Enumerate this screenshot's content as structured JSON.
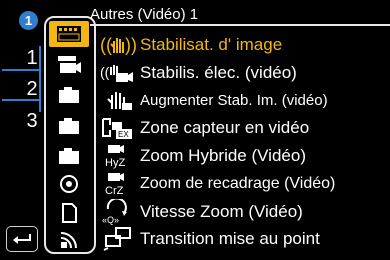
{
  "header": {
    "title": "Autres (Vidéo) 1",
    "page_badge": "1"
  },
  "pages": [
    "1",
    "2",
    "3"
  ],
  "tabs": [
    {
      "icon": "video-film-icon",
      "selected": true
    },
    {
      "icon": "video-camera-icon",
      "selected": false
    },
    {
      "icon": "camera-icon",
      "selected": false
    },
    {
      "icon": "camera-icon",
      "selected": false
    },
    {
      "icon": "camera-icon",
      "selected": false
    },
    {
      "icon": "playback-circle-icon",
      "selected": false
    },
    {
      "icon": "memory-card-icon",
      "selected": false
    },
    {
      "icon": "wireless-signal-icon",
      "selected": false
    }
  ],
  "menu": {
    "items": [
      {
        "label": "Stabilisat. d' image",
        "icon": "hand-shake-icon",
        "active": true
      },
      {
        "label": "Stabilis. élec. (vidéo)",
        "icon": "electronic-stabilizer-icon",
        "active": false
      },
      {
        "label": "Augmenter Stab. Im. (vidéo)",
        "icon": "boost-stabilizer-icon",
        "active": false
      },
      {
        "label": "Zone capteur en vidéo",
        "icon": "sensor-area-icon",
        "active": false
      },
      {
        "label": "Zoom Hybride (Vidéo)",
        "icon": "hybrid-zoom-icon",
        "active": false
      },
      {
        "label": "Zoom de recadrage (Vidéo)",
        "icon": "crop-zoom-icon",
        "active": false
      },
      {
        "label": "Vitesse Zoom (Vidéo)",
        "icon": "zoom-speed-icon",
        "active": false
      },
      {
        "label": "Transition mise au point",
        "icon": "focus-transition-icon",
        "active": false
      }
    ]
  },
  "back_button": {
    "icon": "back-arrow-icon"
  },
  "colors": {
    "accent": "#f2b712",
    "page_highlight": "#2f7fd0",
    "background": "#000000",
    "text": "#ffffff"
  }
}
